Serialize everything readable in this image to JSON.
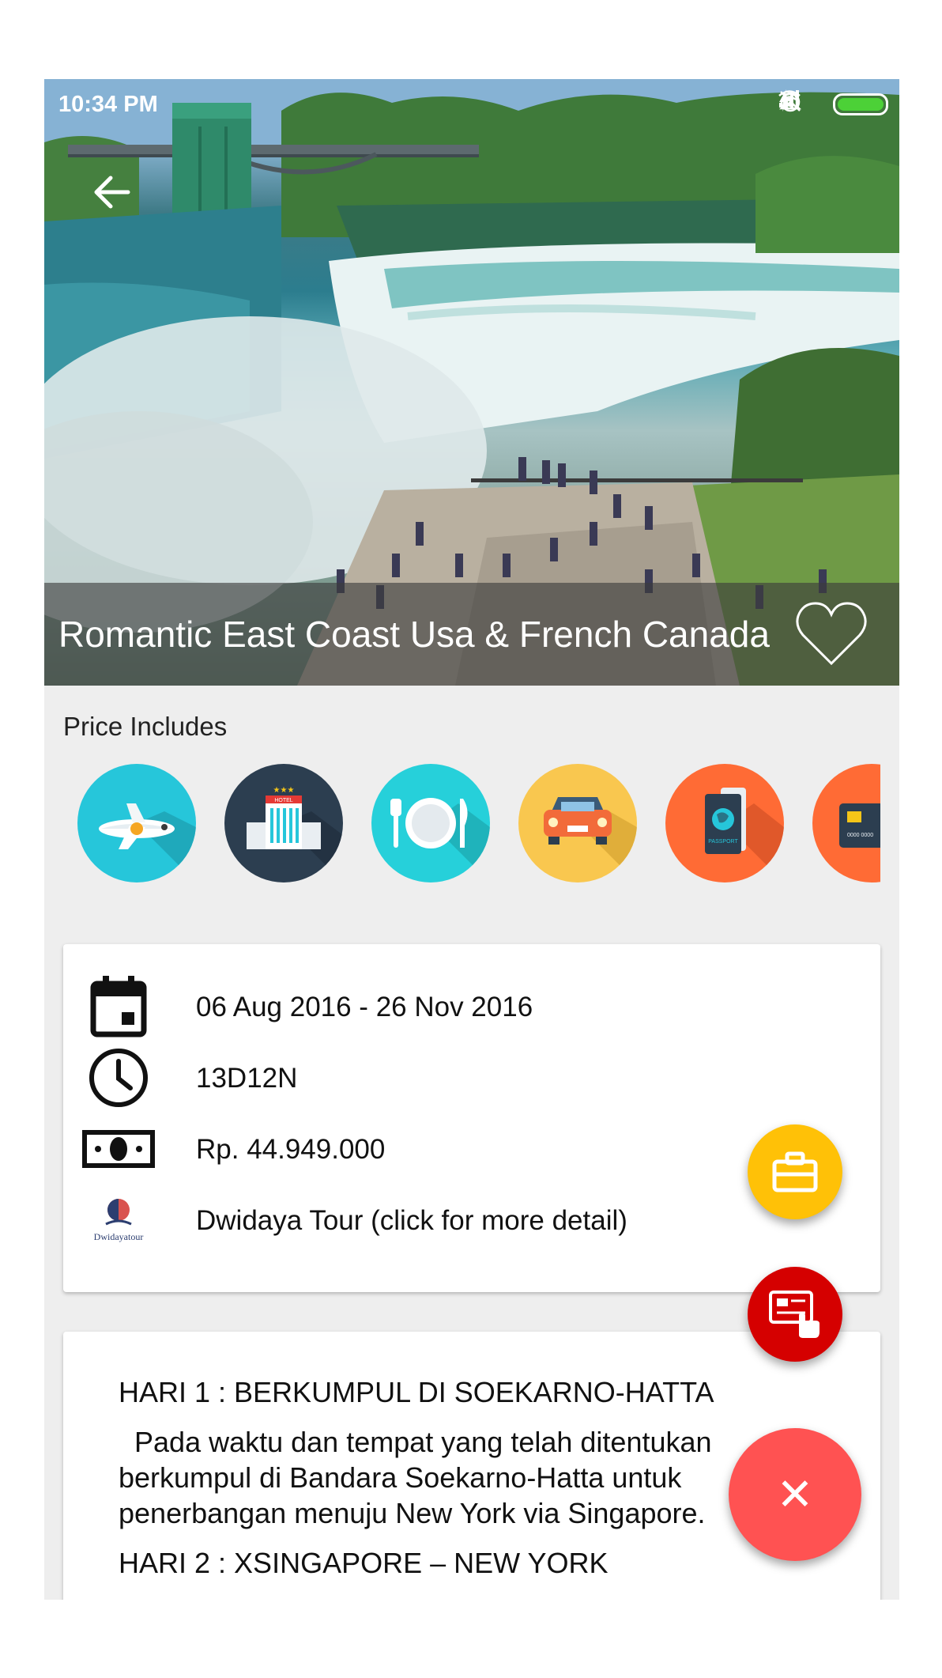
{
  "status_bar": {
    "time": "10:34 PM",
    "icons": [
      "mute-icon",
      "alarm-icon",
      "wifi-icon",
      "signal-icon",
      "charging-icon",
      "battery-icon"
    ]
  },
  "hero": {
    "image": "niagara-falls-photo",
    "title": "Romantic East Coast Usa & French Canada"
  },
  "price_includes": {
    "label": "Price Includes",
    "items": [
      {
        "name": "flight",
        "color": "#26c6da"
      },
      {
        "name": "hotel",
        "color": "#2c3e50"
      },
      {
        "name": "meals",
        "color": "#26d0da"
      },
      {
        "name": "transport",
        "color": "#f9c74f"
      },
      {
        "name": "passport",
        "color": "#ff6b35"
      },
      {
        "name": "card",
        "color": "#ff6b35"
      }
    ],
    "hotel_sign": "HOTEL",
    "passport_text": "PASSPORT",
    "card_number": "0000 0000"
  },
  "info": {
    "date_range": "06 Aug 2016 - 26 Nov 2016",
    "duration": "13D12N",
    "price": "Rp. 44.949.000",
    "operator": "Dwidaya Tour (click for more detail)",
    "operator_logo_text": "Dwidayatour"
  },
  "itinerary": {
    "day1_title": "HARI 1 :  BERKUMPUL DI SOEKARNO-HATTA",
    "day1_body": "  Pada waktu dan tempat yang telah ditentukan berkumpul di Bandara Soekarno-Hatta untuk penerbangan menuju New York via Singapore.",
    "day2_title": "HARI 2 :  XSINGAPORE – NEW YORK"
  },
  "colors": {
    "fab_briefcase": "#ffc107",
    "fab_card": "#d50000",
    "fab_close": "#ff5252",
    "background": "#eeeeee"
  }
}
